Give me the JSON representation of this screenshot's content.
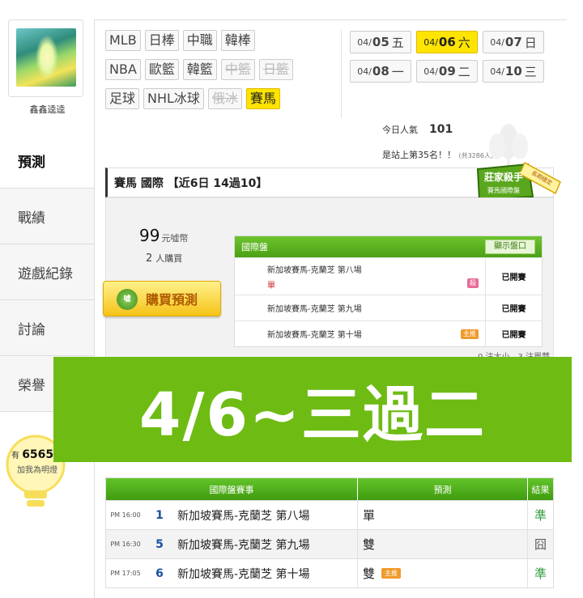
{
  "user": {
    "name": "鑫鑫逵逵"
  },
  "sidebar": {
    "items": [
      {
        "label": "預測"
      },
      {
        "label": "戰績"
      },
      {
        "label": "遊戲紀錄"
      },
      {
        "label": "討論"
      },
      {
        "label": "榮譽"
      }
    ],
    "bulb": {
      "prefix": "有",
      "count": "6565",
      "label": "加我為明燈"
    }
  },
  "sports": {
    "rows": [
      [
        "MLB",
        "日棒",
        "中職",
        "韓棒"
      ],
      [
        "NBA",
        "歐籃",
        "韓籃",
        "中籃",
        "日籃"
      ],
      [
        "足球",
        "NHL冰球",
        "俄冰",
        "賽馬"
      ]
    ],
    "disabled": [
      "中籃",
      "日籃",
      "俄冰"
    ],
    "active": "賽馬"
  },
  "dates": [
    [
      {
        "md": "04/",
        "d": "05",
        "w": "五"
      },
      {
        "md": "04/",
        "d": "06",
        "w": "六",
        "active": true
      },
      {
        "md": "04/",
        "d": "07",
        "w": "日"
      }
    ],
    [
      {
        "md": "04/",
        "d": "08",
        "w": "一"
      },
      {
        "md": "04/",
        "d": "09",
        "w": "二"
      },
      {
        "md": "04/",
        "d": "10",
        "w": "三"
      }
    ]
  ],
  "stats": {
    "today_label": "今日人氣",
    "today_value": "101",
    "rank_text": "是站上第35名！！",
    "rank_small": "(共3286人)"
  },
  "card": {
    "title": "賽馬 國際 【近6日 14過10】",
    "badge_line1": "莊家殺手",
    "badge_line2": "賽馬國際盤",
    "badge_ribbon": "長期穩定",
    "price_value": "99",
    "price_unit": "元噓幣",
    "buyers_value": "2",
    "buyers_unit": "人購買",
    "buy_button": "購買預測",
    "buy_coin": "噓"
  },
  "intl": {
    "header": "國際盤",
    "show_button": "顯示盤口",
    "rows": [
      {
        "match": "新加坡賽馬-克蘭芝 第八場",
        "pick": "單",
        "tag": "殺",
        "status": "已開賽"
      },
      {
        "match": "新加坡賽馬-克蘭芝 第九場",
        "pick": "",
        "tag": "",
        "status": "已開賽"
      },
      {
        "match": "新加坡賽馬-克蘭芝 第十場",
        "pick": "",
        "tag": "主推",
        "status": "已開賽"
      }
    ],
    "summary": "0 注大小，3 注單雙"
  },
  "overlay": {
    "text": "4/6~三過二"
  },
  "results": {
    "headers": [
      "國際盤賽事",
      "預測",
      "結果"
    ],
    "rows": [
      {
        "time": "PM 16:00",
        "num": "1",
        "match": "新加坡賽馬-克蘭芝 第八場",
        "pick": "單",
        "tag": "",
        "result": "準"
      },
      {
        "time": "PM 16:30",
        "num": "5",
        "match": "新加坡賽馬-克蘭芝 第九場",
        "pick": "雙",
        "tag": "",
        "result": "囧"
      },
      {
        "time": "PM 17:05",
        "num": "6",
        "match": "新加坡賽馬-克蘭芝 第十場",
        "pick": "雙",
        "tag": "主推",
        "result": "準"
      }
    ]
  },
  "colors": {
    "accent_green": "#6ebb14",
    "active_yellow": "#ffe400",
    "win_green": "#2e9a3a"
  }
}
